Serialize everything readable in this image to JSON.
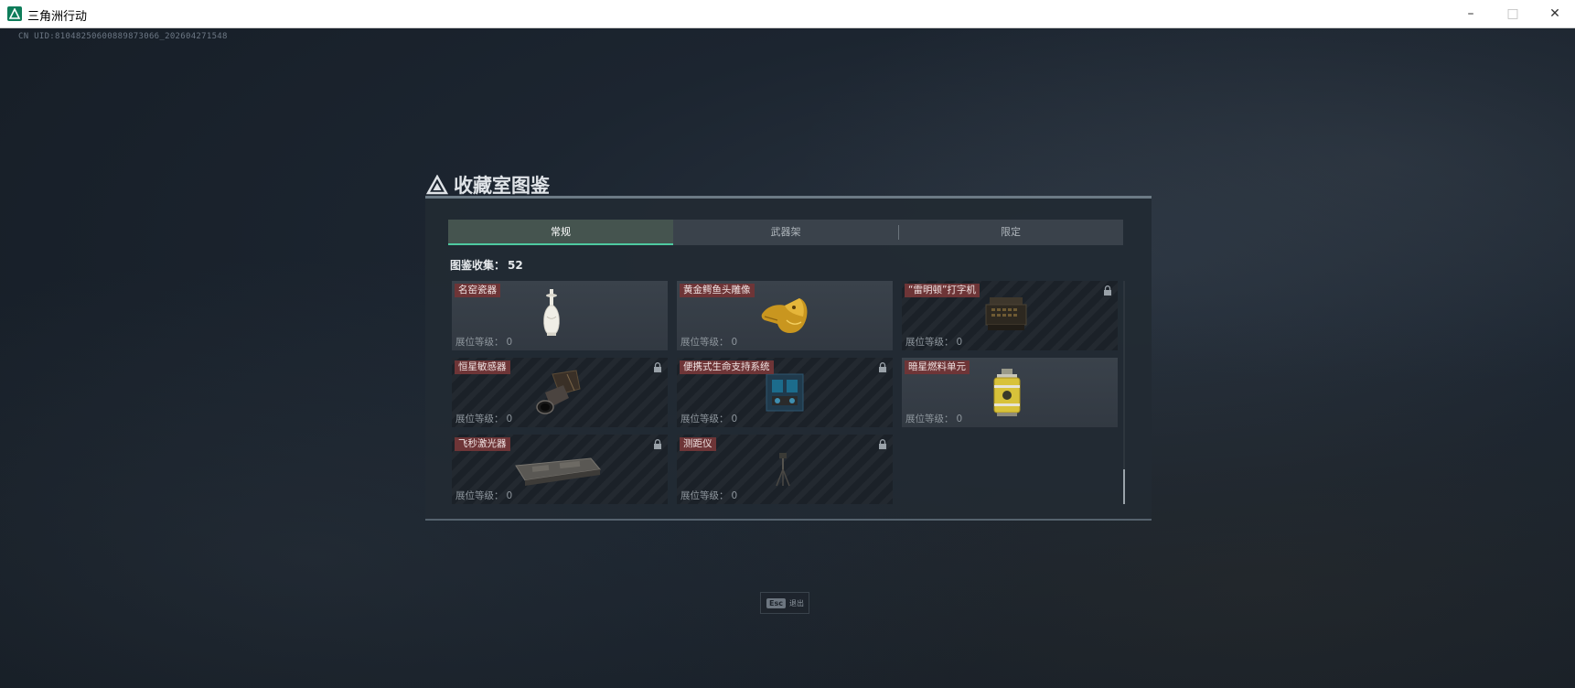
{
  "window": {
    "title": "三角洲行动",
    "min": "–",
    "max": "□",
    "close": "✕"
  },
  "uid_text": "CN UID:81048250600889873066_202604271548",
  "panel": {
    "title": "收藏室图鉴"
  },
  "tabs": [
    {
      "label": "常规",
      "active": true
    },
    {
      "label": "武器架",
      "active": false
    },
    {
      "label": "限定",
      "active": false
    }
  ],
  "collection": {
    "label": "图鉴收集：",
    "value": "52"
  },
  "level_label": "展位等级：",
  "items": [
    {
      "name": "名窑瓷器",
      "level": "0",
      "locked": false,
      "icon": "porcelain-vase-icon"
    },
    {
      "name": "黄金鳄鱼头雕像",
      "level": "0",
      "locked": false,
      "icon": "gold-crocodile-head-icon"
    },
    {
      "name": "“雷明顿”打字机",
      "level": "0",
      "locked": true,
      "icon": "typewriter-icon"
    },
    {
      "name": "恒星敏感器",
      "level": "0",
      "locked": true,
      "icon": "star-sensor-icon"
    },
    {
      "name": "便携式生命支持系统",
      "level": "0",
      "locked": true,
      "icon": "life-support-icon"
    },
    {
      "name": "暗星燃料单元",
      "level": "0",
      "locked": false,
      "icon": "fuel-cell-icon"
    },
    {
      "name": "飞秒激光器",
      "level": "0",
      "locked": true,
      "icon": "femtosecond-laser-icon"
    },
    {
      "name": "测距仪",
      "level": "0",
      "locked": true,
      "icon": "rangefinder-icon"
    }
  ],
  "esc": {
    "key": "Esc",
    "label": "退出"
  },
  "colors": {
    "accent": "#4ec9a0",
    "name_badge": "#6e3537",
    "panel_bg": "#222a33"
  }
}
